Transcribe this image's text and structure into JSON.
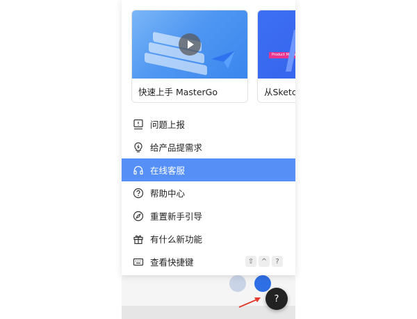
{
  "cards": [
    {
      "label": "快速上手 MasterGo"
    },
    {
      "label": "从Sketch",
      "badge": "Product Manage"
    }
  ],
  "menu": [
    {
      "label": "问题上报",
      "icon": "report-icon",
      "active": false
    },
    {
      "label": "给产品提需求",
      "icon": "lightbulb-icon",
      "active": false
    },
    {
      "label": "在线客服",
      "icon": "headset-icon",
      "active": true
    },
    {
      "label": "帮助中心",
      "icon": "question-circle-icon",
      "active": false
    },
    {
      "label": "重置新手引导",
      "icon": "compass-icon",
      "active": false
    },
    {
      "label": "有什么新功能",
      "icon": "gift-icon",
      "active": false
    },
    {
      "label": "查看快捷键",
      "icon": "keyboard-icon",
      "active": false
    }
  ],
  "shortcut": {
    "keys": [
      "⇧",
      "^",
      "?"
    ]
  },
  "help_button": {
    "label": "?"
  },
  "colors": {
    "accent": "#5690f7",
    "annotation_arrow": "#e23a2e"
  }
}
